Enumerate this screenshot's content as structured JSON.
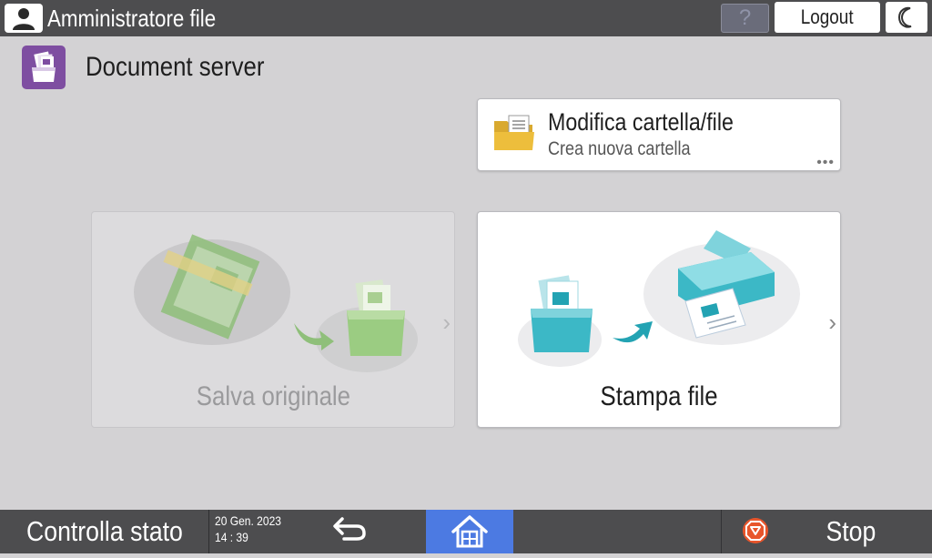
{
  "header": {
    "user_title": "Amministratore file",
    "help_label": "?",
    "logout_label": "Logout",
    "user_icon": "user-icon",
    "night_icon": "moon-icon"
  },
  "app": {
    "title": "Document server",
    "icon": "document-server-icon"
  },
  "cards": {
    "folder": {
      "title": "Modifica cartella/file",
      "subtitle": "Crea nuova cartella",
      "more": "•••",
      "icon": "folder-icon"
    },
    "save": {
      "label": "Salva originale",
      "enabled": false,
      "chevron": "›"
    },
    "print": {
      "label": "Stampa file",
      "enabled": true,
      "chevron": "›"
    }
  },
  "footer": {
    "status_label": "Controlla stato",
    "date": "20 Gen. 2023",
    "time": "14 : 39",
    "stop_label": "Stop",
    "back_icon": "back-arrow-icon",
    "home_icon": "home-icon",
    "stop_icon": "stop-icon"
  },
  "colors": {
    "topbar": "#4d4d4f",
    "background": "#d3d2d4",
    "home_accent": "#4c7ae2",
    "app_icon": "#7e4ea1",
    "print_teal": "#3cb8c6",
    "save_green": "#8fc46b",
    "stop_orange": "#e8552b"
  }
}
